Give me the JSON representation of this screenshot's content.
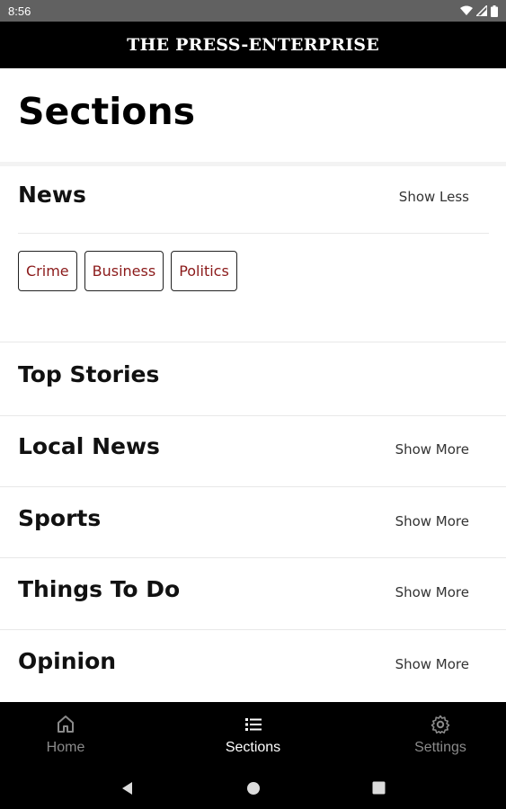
{
  "status_bar": {
    "time": "8:56",
    "icons": [
      "wifi-icon",
      "signal-icon",
      "battery-icon"
    ]
  },
  "masthead": {
    "title": "THE PRESS-ENTERPRISE"
  },
  "page": {
    "title": "Sections"
  },
  "sections": [
    {
      "name": "News",
      "toggle": "Show Less",
      "expanded": true,
      "subsections": [
        "Crime",
        "Business",
        "Politics"
      ]
    },
    {
      "name": "Top Stories",
      "toggle": ""
    },
    {
      "name": "Local News",
      "toggle": "Show More"
    },
    {
      "name": "Sports",
      "toggle": "Show More"
    },
    {
      "name": "Things To Do",
      "toggle": "Show More"
    },
    {
      "name": "Opinion",
      "toggle": "Show More"
    }
  ],
  "bottom_nav": {
    "items": [
      {
        "label": "Home",
        "icon": "home-icon",
        "active": false
      },
      {
        "label": "Sections",
        "icon": "list-icon",
        "active": true
      },
      {
        "label": "Settings",
        "icon": "gear-icon",
        "active": false
      }
    ]
  },
  "system_nav": {
    "icons": [
      "back-icon",
      "home-circle-icon",
      "recents-icon"
    ]
  },
  "colors": {
    "status_bar": "#616161",
    "masthead": "#000000",
    "chip_text": "#8b1a1a",
    "nav_active": "#ffffff",
    "nav_inactive": "#8a8a8a"
  }
}
